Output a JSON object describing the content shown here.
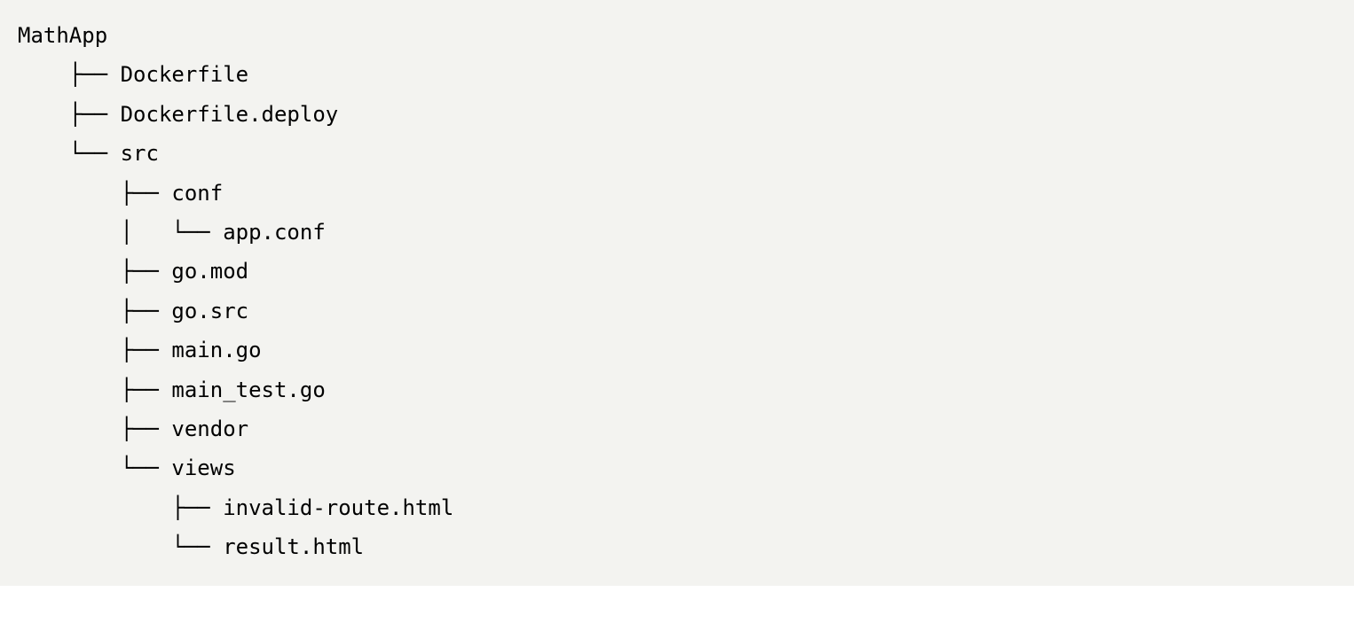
{
  "tree": {
    "root": "MathApp",
    "lines": [
      "MathApp",
      "    ├── Dockerfile",
      "    ├── Dockerfile.deploy",
      "    └── src",
      "        ├── conf",
      "        │   └── app.conf",
      "        ├── go.mod",
      "        ├── go.src",
      "        ├── main.go",
      "        ├── main_test.go",
      "        ├── vendor",
      "        └── views",
      "            ├── invalid-route.html",
      "            └── result.html"
    ]
  }
}
